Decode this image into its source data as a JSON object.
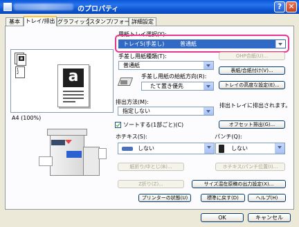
{
  "window": {
    "title": "のプロパティ",
    "help_glyph": "?",
    "close_glyph": "✕"
  },
  "tabs": [
    "基本",
    "トレイ/排出",
    "グラフィックス",
    "スタンプ/フォーム",
    "詳細設定"
  ],
  "tray": {
    "select_label": "用紙トレイ選択(Y):",
    "select_value_tray": "トレイ5(手差し)",
    "select_value_paper": "普通紙",
    "bypass_type_label": "手差し用紙種類(T):",
    "bypass_type_value": "普通紙",
    "ohp_button": "OHP合紙(U)...",
    "cover_button": "表紙/合紙付け(V)...",
    "orientation_label": "手差し用紙の給紙方向(R):",
    "orientation_value": "たて置き優先",
    "advanced_button": "トレイの高度な設定(E)..."
  },
  "preview": {
    "paper_size": "A4 (100%)"
  },
  "output": {
    "label": "排出方法(M):",
    "value": "指定しない",
    "tray_note": "排出トレイに排出されます。",
    "offset_button": "オフセット排出(G)...",
    "sort_label": "ソートする(1部ごと)(C)",
    "stapler_label": "ホチキス(S):",
    "stapler_value": "しない",
    "punch_label": "パンチ(Q):",
    "punch_value": "しない",
    "fold_button": "紙折り/中とじ(B)...",
    "staple_pos_button": "ホチキス/パンチ位置(I)...",
    "zfold_button": "Z折り(Z)...",
    "mixed_button": "サイズ混在原稿の出力設定(X)..."
  },
  "footer_buttons": {
    "printer_status": "プリンターの状態(U)",
    "restore_default": "標準に戻す(D)",
    "help": "ヘルプ(H)"
  },
  "dialog_buttons": {
    "ok": "OK",
    "cancel": "キャンセル"
  },
  "icons": {
    "a": "a"
  },
  "colors": {
    "highlight": "#e6358c",
    "selection": "#316ac5",
    "titlebar": "#0a57d8"
  }
}
